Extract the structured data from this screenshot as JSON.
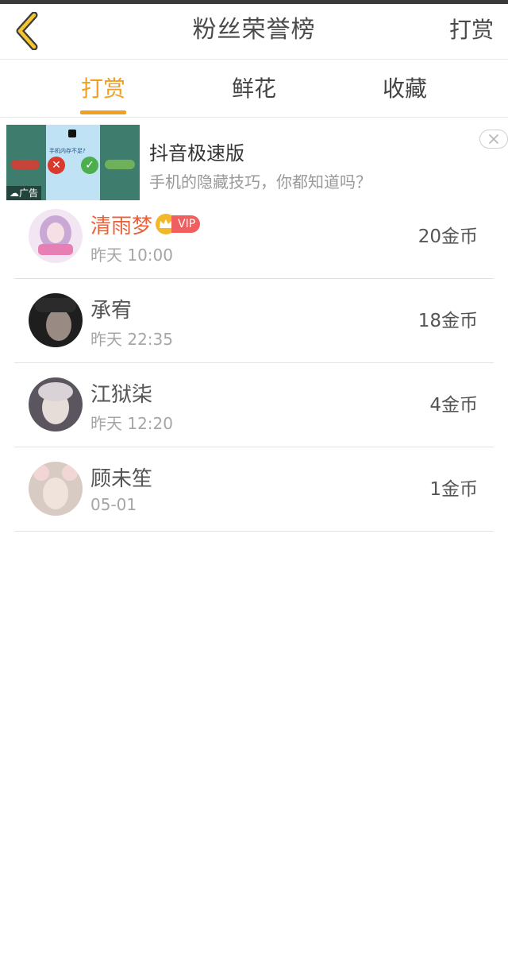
{
  "header": {
    "title": "粉丝荣誉榜",
    "action": "打赏"
  },
  "tabs": [
    {
      "label": "打赏",
      "active": true
    },
    {
      "label": "鲜花",
      "active": false
    },
    {
      "label": "收藏",
      "active": false
    }
  ],
  "ad": {
    "title": "抖音极速版",
    "subtitle": "手机的隐藏技巧，你都知道吗？",
    "badge": "广告",
    "thumb_text": "手机内存不足?"
  },
  "list": [
    {
      "name": "清雨梦",
      "vip": true,
      "vip_label": "VIP",
      "time": "昨天 10:00",
      "coins": "20金币"
    },
    {
      "name": "承宥",
      "vip": false,
      "time": "昨天 22:35",
      "coins": "18金币"
    },
    {
      "name": "江狱柒",
      "vip": false,
      "time": "昨天 12:20",
      "coins": "4金币"
    },
    {
      "name": "顾未笙",
      "vip": false,
      "time": "05-01",
      "coins": "1金币"
    }
  ],
  "colors": {
    "accent": "#f0a020",
    "vip_name": "#e8623a",
    "vip_tag": "#ef5f5f",
    "crown": "#f3b82a"
  }
}
